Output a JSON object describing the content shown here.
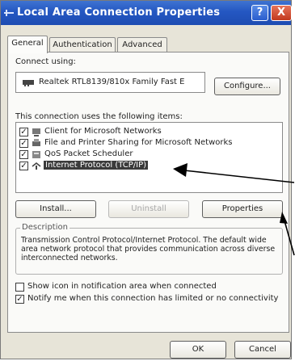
{
  "window": {
    "title": "Local Area Connection Properties",
    "help_button": "?",
    "close_button": "X"
  },
  "tabs": [
    {
      "label": "General",
      "active": true
    },
    {
      "label": "Authentication",
      "active": false
    },
    {
      "label": "Advanced",
      "active": false
    }
  ],
  "connect": {
    "label": "Connect using:",
    "adapter": "Realtek RTL8139/810x Family Fast E",
    "configure_label": "Configure..."
  },
  "components": {
    "label": "This connection uses the following items:",
    "items": [
      {
        "label": "Client for Microsoft Networks",
        "checked": true,
        "selected": false,
        "icon": "network-client-icon"
      },
      {
        "label": "File and Printer Sharing for Microsoft Networks",
        "checked": true,
        "selected": false,
        "icon": "file-printer-sharing-icon"
      },
      {
        "label": "QoS Packet Scheduler",
        "checked": true,
        "selected": false,
        "icon": "qos-scheduler-icon"
      },
      {
        "label": "Internet Protocol (TCP/IP)",
        "checked": true,
        "selected": true,
        "icon": "protocol-icon"
      }
    ]
  },
  "buttons": {
    "install": "Install...",
    "uninstall": "Uninstall",
    "properties": "Properties",
    "ok": "OK",
    "cancel": "Cancel"
  },
  "description": {
    "legend": "Description",
    "text": "Transmission Control Protocol/Internet Protocol. The default wide area network protocol that provides communication across diverse interconnected networks."
  },
  "options": [
    {
      "label": "Show icon in notification area when connected",
      "checked": false
    },
    {
      "label": "Notify me when this connection has limited or no connectivity",
      "checked": true
    }
  ],
  "colors": {
    "titlebar": "#2457c2",
    "selection": "#3b3b3b",
    "dialog_bg": "#e7e4d8"
  }
}
